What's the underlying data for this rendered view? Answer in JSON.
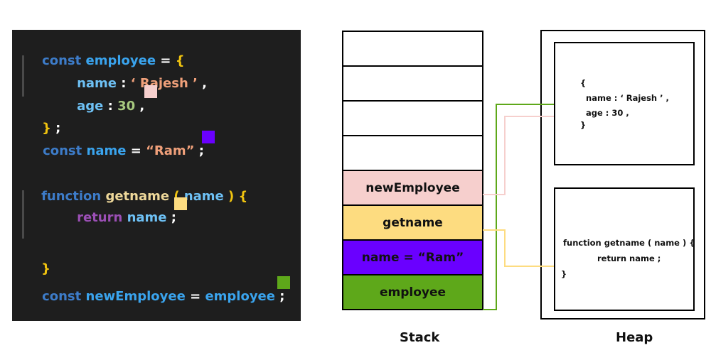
{
  "code": {
    "lines": {
      "l1": {
        "kw": "const",
        "ident": "employee",
        "op": " = ",
        "brace": "{"
      },
      "l2": {
        "prop": "name",
        "colon": " : ",
        "str": "‘ Rajesh ’",
        "end": " ,"
      },
      "l3": {
        "prop": "age",
        "colon": " : ",
        "num": "30",
        "end": " ,"
      },
      "l4": {
        "brace": "}",
        "end": " ;"
      },
      "l5": {
        "kw": "const",
        "ident": "name",
        "op": " = ",
        "str": "“Ram”",
        "end": " ;"
      },
      "l6": {
        "kw": "function",
        "fn": "getname",
        "open": " ( ",
        "param": "name",
        "close": " ) ",
        "brace": "{"
      },
      "l7": {
        "ret": "return",
        "ident": "name",
        "end": " ;"
      },
      "l8": {
        "brace": "}"
      },
      "l9": {
        "kw": "const",
        "ident": "newEmployee",
        "op": " = ",
        "ident2": "employee",
        "end": " ;"
      }
    },
    "swatches": {
      "employee_object": "#f6cfcd",
      "name_value": "#6a00ff",
      "getname_function": "#fddc80",
      "new_employee": "#5ea81a"
    }
  },
  "stack": {
    "label": "Stack",
    "cells": [
      {
        "text": "",
        "color": "#ffffff"
      },
      {
        "text": "",
        "color": "#ffffff"
      },
      {
        "text": "",
        "color": "#ffffff"
      },
      {
        "text": "",
        "color": "#ffffff"
      },
      {
        "text": "newEmployee",
        "color": "#f6cfcd"
      },
      {
        "text": "getname",
        "color": "#fddc80"
      },
      {
        "text": "name = “Ram”",
        "color": "#6a00ff"
      },
      {
        "text": "employee",
        "color": "#5ea81a"
      }
    ]
  },
  "heap": {
    "label": "Heap",
    "object_box": {
      "lines": [
        "{",
        "  name : ‘ Rajesh ’ ,",
        "  age : 30 ,",
        "}"
      ]
    },
    "function_box": {
      "lines": [
        "function getname ( name ) {",
        "return name ;",
        "}"
      ]
    }
  },
  "connectors": {
    "employee_to_object": "#5ea81a",
    "newEmployee_to_object": "#f6cfcd",
    "getname_to_function": "#fddc80"
  }
}
